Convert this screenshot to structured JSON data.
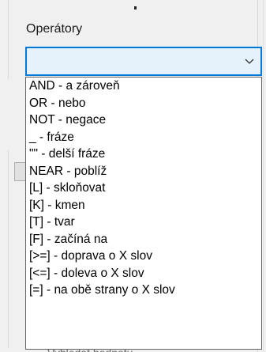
{
  "operators": {
    "label": "Operátory",
    "combo_value": "",
    "arrow_icon": "chevron-down-icon",
    "accent_color": "#0078d7",
    "items": [
      "AND - a zároveň",
      "OR - nebo",
      "NOT - negace",
      "_ - fráze",
      "\"\" - delší fráze",
      "NEAR - poblíž",
      "[L] - skloňovat",
      "[K] - kmen",
      "[T] - tvar",
      "[F] - začíná na",
      "[>=] - doprava o X slov",
      "[<=] - doleva o X slov",
      "[=] - na obě strany o X slov"
    ]
  },
  "background": {
    "partial_text": "Vyhledat hodnotu"
  }
}
